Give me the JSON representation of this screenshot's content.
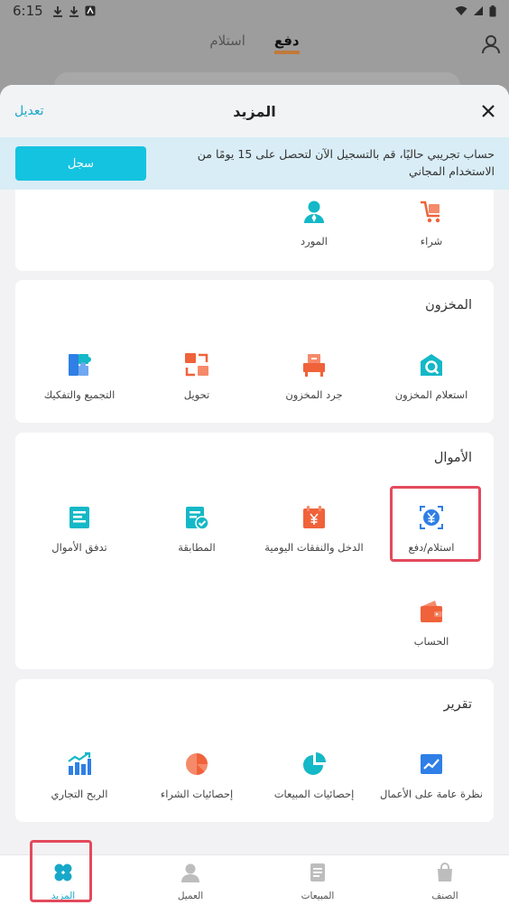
{
  "status_bar": {
    "time": "6:15"
  },
  "background": {
    "tabs": [
      {
        "label": "دفع",
        "active": true
      },
      {
        "label": "استلام",
        "active": false
      }
    ]
  },
  "sheet": {
    "title": "المزيد",
    "edit_label": "تعديل",
    "trial_text": "حساب تجريبي حاليًا، قم بالتسجيل الآن لتحصل على 15 يومًا من الاستخدام المجاني",
    "register_label": "سجل"
  },
  "sections": {
    "top": {
      "items": [
        {
          "label": "شراء",
          "icon": "cart-icon"
        },
        {
          "label": "المورد",
          "icon": "supplier-icon"
        }
      ]
    },
    "inventory": {
      "title": "المخزون",
      "items": [
        {
          "label": "استعلام المخزون",
          "icon": "inventory-query-icon"
        },
        {
          "label": "جرد المخزون",
          "icon": "stocktake-icon"
        },
        {
          "label": "تحويل",
          "icon": "transfer-icon"
        },
        {
          "label": "التجميع والتفكيك",
          "icon": "assembly-icon"
        }
      ]
    },
    "funds": {
      "title": "الأموال",
      "items": [
        {
          "label": "استلام/دفع",
          "icon": "receive-pay-icon",
          "highlighted": true
        },
        {
          "label": "الدخل والنفقات اليومية",
          "icon": "daily-income-icon"
        },
        {
          "label": "المطابقة",
          "icon": "reconcile-icon"
        },
        {
          "label": "تدفق الأموال",
          "icon": "cash-flow-icon"
        },
        {
          "label": "الحساب",
          "icon": "wallet-icon"
        }
      ]
    },
    "report": {
      "title": "تقرير",
      "items": [
        {
          "label": "نظرة عامة على الأعمال",
          "icon": "business-overview-icon"
        },
        {
          "label": "إحصائيات المبيعات",
          "icon": "sales-stats-icon"
        },
        {
          "label": "إحصائيات الشراء",
          "icon": "purchase-stats-icon"
        },
        {
          "label": "الربح التجاري",
          "icon": "profit-icon"
        }
      ]
    }
  },
  "bottom_nav": [
    {
      "label": "الصنف",
      "icon": "bag-icon"
    },
    {
      "label": "المبيعات",
      "icon": "document-icon"
    },
    {
      "label": "العميل",
      "icon": "customer-icon"
    },
    {
      "label": "المزيد",
      "icon": "clover-icon",
      "active": true
    }
  ],
  "colors": {
    "accent": "#17a8c9",
    "icon_orange": "#f0623a",
    "icon_teal": "#14b8c7",
    "icon_blue": "#2e7fe6",
    "highlight": "#e34a5c"
  }
}
